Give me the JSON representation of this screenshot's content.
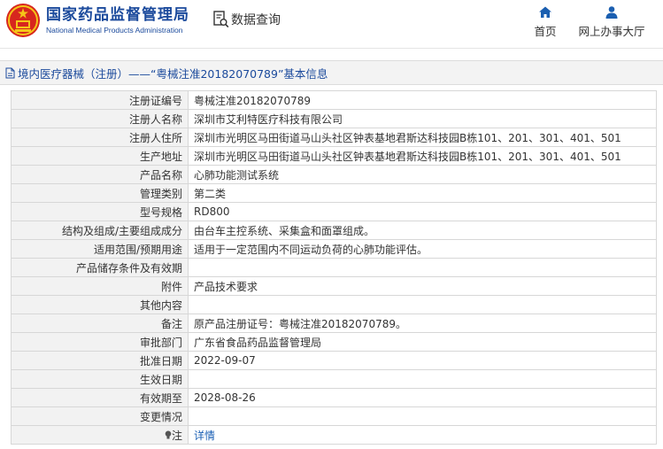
{
  "header": {
    "logo_cn": "国家药品监督管理局",
    "logo_en": "National Medical Products Administration",
    "data_query": "数据查询",
    "nav": [
      {
        "label": "首页",
        "icon": "home-icon"
      },
      {
        "label": "网上办事大厅",
        "icon": "user-icon"
      }
    ]
  },
  "title_bar": {
    "text": "境内医疗器械（注册）——“粤械注准20182070789”基本信息"
  },
  "rows": [
    {
      "label": "注册证编号",
      "value": "粤械注准20182070789"
    },
    {
      "label": "注册人名称",
      "value": "深圳市艾利特医疗科技有限公司"
    },
    {
      "label": "注册人住所",
      "value": "深圳市光明区马田街道马山头社区钟表基地君斯达科技园B栋101、201、301、401、501"
    },
    {
      "label": "生产地址",
      "value": "深圳市光明区马田街道马山头社区钟表基地君斯达科技园B栋101、201、301、401、501"
    },
    {
      "label": "产品名称",
      "value": "心肺功能测试系统"
    },
    {
      "label": "管理类别",
      "value": "第二类"
    },
    {
      "label": "型号规格",
      "value": "RD800"
    },
    {
      "label": "结构及组成/主要组成成分",
      "value": "由台车主控系统、采集盒和面罩组成。"
    },
    {
      "label": "适用范围/预期用途",
      "value": "适用于一定范围内不同运动负荷的心肺功能评估。"
    },
    {
      "label": "产品储存条件及有效期",
      "value": ""
    },
    {
      "label": "附件",
      "value": "产品技术要求"
    },
    {
      "label": "其他内容",
      "value": ""
    },
    {
      "label": "备注",
      "value": "原产品注册证号：粤械注准20182070789。"
    },
    {
      "label": "审批部门",
      "value": "广东省食品药品监督管理局"
    },
    {
      "label": "批准日期",
      "value": "2022-09-07"
    },
    {
      "label": "生效日期",
      "value": ""
    },
    {
      "label": "有效期至",
      "value": "2028-08-26"
    },
    {
      "label": "变更情况",
      "value": ""
    }
  ],
  "note_row": {
    "label": "注",
    "link": "详情"
  },
  "colors": {
    "brand_blue": "#1b4a9c",
    "link_blue": "#1a5fb4",
    "label_bg": "#f2f2f2",
    "emblem_red": "#d7261e",
    "emblem_gold": "#f5c518"
  }
}
